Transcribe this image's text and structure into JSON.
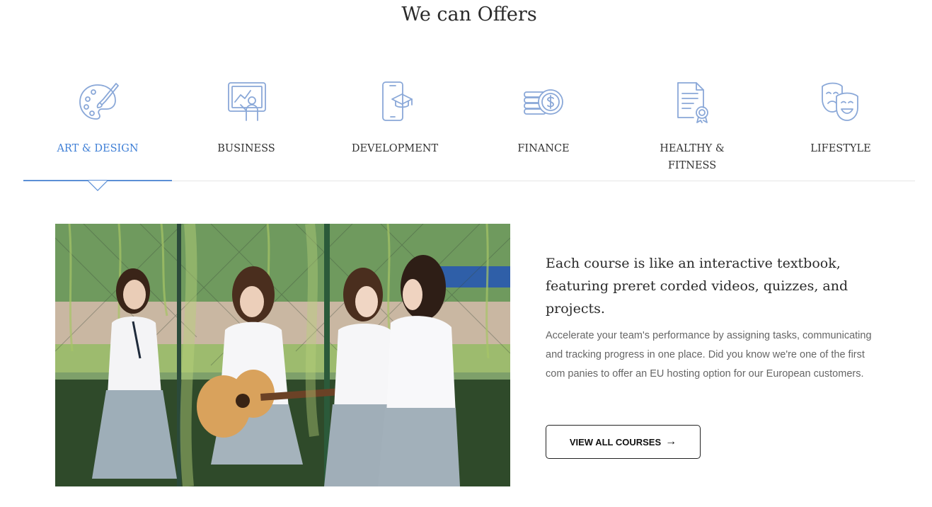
{
  "section": {
    "title": "We can Offers"
  },
  "tabs": [
    {
      "label": "ART & DESIGN",
      "icon": "palette-icon",
      "active": true
    },
    {
      "label": "BUSINESS",
      "icon": "presentation-board-icon",
      "active": false
    },
    {
      "label": "DEVELOPMENT",
      "icon": "mobile-graduation-icon",
      "active": false
    },
    {
      "label": "FINANCE",
      "icon": "coins-dollar-icon",
      "active": false
    },
    {
      "label": "HEALTHY & FITNESS",
      "icon": "certificate-document-icon",
      "active": false
    },
    {
      "label": "LIFESTYLE",
      "icon": "theater-masks-icon",
      "active": false
    }
  ],
  "content": {
    "headline": "Each course is like an interactive textbook, featuring preret corded videos, quizzes, and projects.",
    "description": "Accelerate your team's performance by assigning tasks, communicating and tracking progress in one place. Did you know we're one of the first com panies to offer an EU hosting option for our European customers.",
    "button_label": "VIEW ALL COURSES",
    "button_icon": "arrow-right-icon",
    "image": "students-playing-guitar-photo"
  },
  "colors": {
    "accent": "#3f7fd6",
    "icon_stroke": "#8aa8d8",
    "text_dark": "#2a2a2a",
    "text_muted": "#666666"
  }
}
